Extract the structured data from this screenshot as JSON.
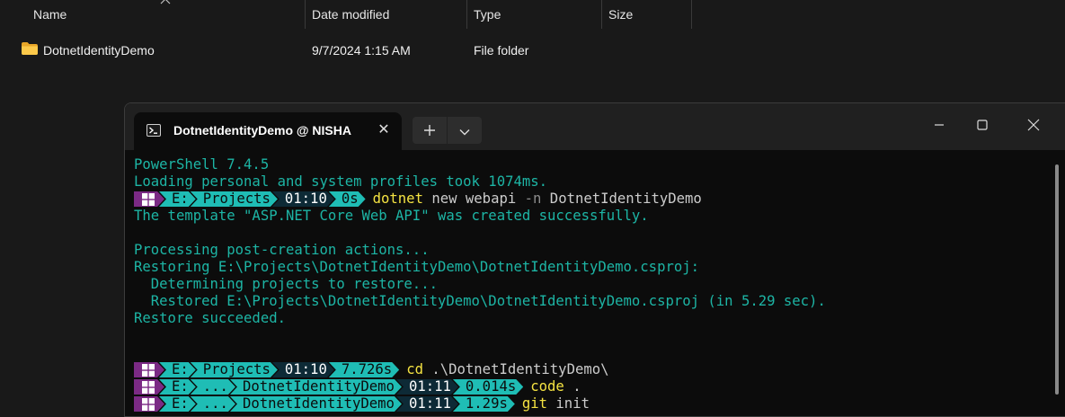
{
  "explorer": {
    "columns": {
      "name": "Name",
      "date": "Date modified",
      "type": "Type",
      "size": "Size"
    },
    "rows": [
      {
        "name": "DotnetIdentityDemo",
        "date": "9/7/2024 1:15 AM",
        "type": "File folder",
        "size": "",
        "icon": "folder-icon"
      }
    ]
  },
  "terminal": {
    "tab_title": "DotnetIdentityDemo @ NISHA",
    "tab_icon": "powershell-icon",
    "output": {
      "l1": "PowerShell 7.4.5",
      "l2": "Loading personal and system profiles took 1074ms.",
      "l4": "The template \"ASP.NET Core Web API\" was created successfully.",
      "l6": "Processing post-creation actions...",
      "l7": "Restoring E:\\Projects\\DotnetIdentityDemo\\DotnetIdentityDemo.csproj:",
      "l8": "  Determining projects to restore...",
      "l9": "  Restored E:\\Projects\\DotnetIdentityDemo\\DotnetIdentityDemo.csproj (in 5.29 sec).",
      "l10": "Restore succeeded."
    },
    "prompts": [
      {
        "drive": "E:",
        "path": [
          "Projects"
        ],
        "time": "01:10",
        "duration": "0s",
        "cmd": "dotnet",
        "args": " new webapi ",
        "flag": "-n",
        "rest": " DotnetIdentityDemo"
      },
      {
        "drive": "E:",
        "path": [
          "Projects"
        ],
        "time": "01:10",
        "duration": "7.726s",
        "cmd": "cd",
        "args": " .\\DotnetIdentityDemo\\"
      },
      {
        "drive": "E:",
        "path": [
          "...",
          "DotnetIdentityDemo"
        ],
        "time": "01:11",
        "duration": "0.014s",
        "cmd": "code",
        "args": " ."
      },
      {
        "drive": "E:",
        "path": [
          "...",
          "DotnetIdentityDemo"
        ],
        "time": "01:11",
        "duration": "1.29s",
        "cmd": "git",
        "args": " init"
      }
    ]
  },
  "colors": {
    "accent": "#1fbdb5",
    "os_segment": "#7b2a85",
    "command": "#f5e342",
    "output": "#1db5a5"
  }
}
